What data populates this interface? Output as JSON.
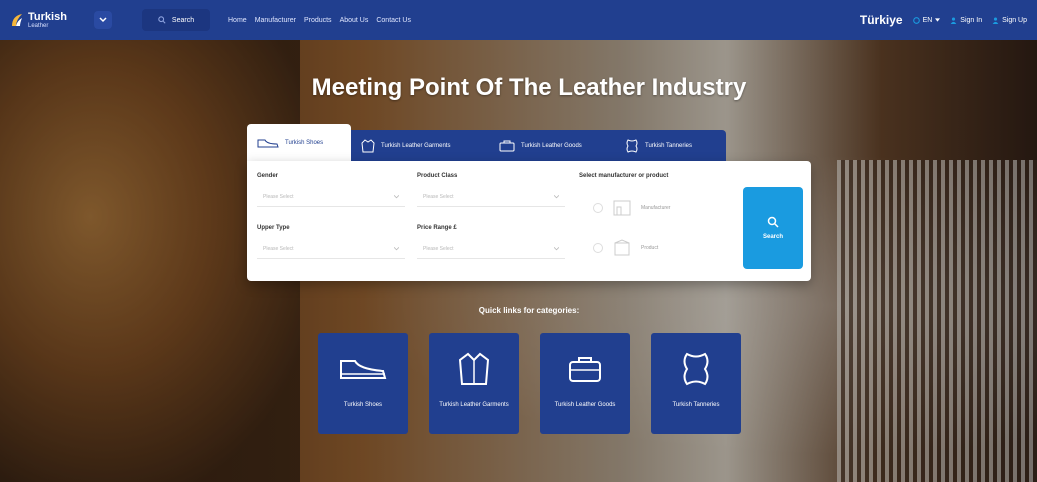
{
  "navbar": {
    "logo_title": "Turkish",
    "logo_sub": "Leather",
    "search_label": "Search",
    "links": [
      "Home",
      "Manufacturer",
      "Products",
      "About Us",
      "Contact Us"
    ],
    "country": "Türkiye",
    "language": "EN",
    "sign_in": "Sign In",
    "sign_up": "Sign Up",
    "colors": {
      "bar": "#213f8f",
      "accent": "#1a9be0"
    }
  },
  "hero": {
    "title": "Meeting Point Of The Leather Industry"
  },
  "search_panel": {
    "tabs": [
      {
        "label": "Turkish Shoes",
        "icon": "shoe-icon",
        "active": true
      },
      {
        "label": "Turkish Leather Garments",
        "icon": "garment-icon",
        "active": false
      },
      {
        "label": "Turkish Leather Goods",
        "icon": "goods-icon",
        "active": false
      },
      {
        "label": "Turkish Tanneries",
        "icon": "hide-icon",
        "active": false
      }
    ],
    "fields": {
      "gender": {
        "label": "Gender",
        "placeholder": "Please Select"
      },
      "product_class": {
        "label": "Product Class",
        "placeholder": "Please Select"
      },
      "upper_type": {
        "label": "Upper Type",
        "placeholder": "Please Select"
      },
      "price_range": {
        "label": "Price Range £",
        "placeholder": "Please Select"
      }
    },
    "select_label": "Select manufacturer or product",
    "options": {
      "manufacturer": "Manufacturer",
      "product": "Product"
    },
    "search_button": "Search"
  },
  "quick_links": {
    "title": "Quick links for categories:",
    "items": [
      {
        "label": "Turkish Shoes",
        "icon": "shoe-icon"
      },
      {
        "label": "Turkish Leather Garments",
        "icon": "garment-icon"
      },
      {
        "label": "Turkish Leather Goods",
        "icon": "briefcase-icon"
      },
      {
        "label": "Turkish Tanneries",
        "icon": "hide-icon"
      }
    ]
  }
}
